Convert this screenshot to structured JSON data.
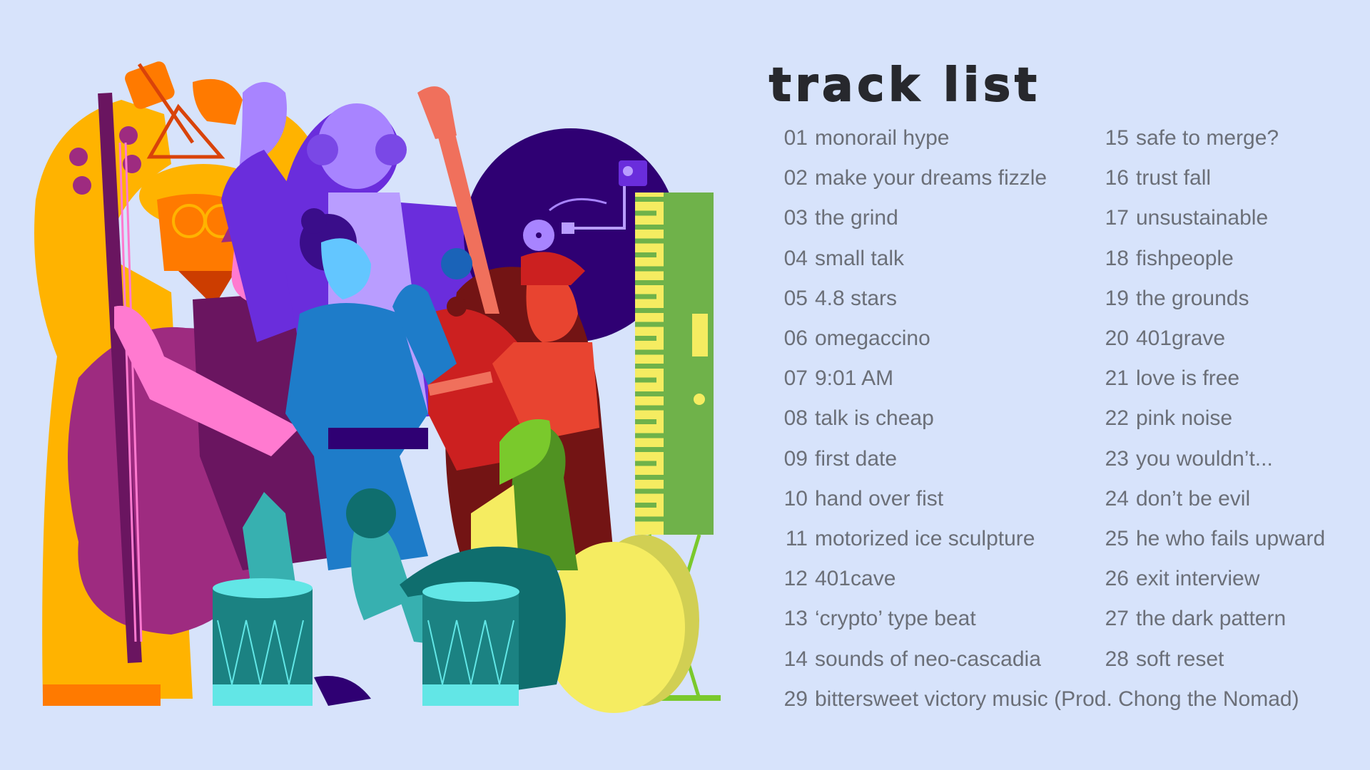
{
  "title": "track list",
  "colors": {
    "background": "#d7e3fb",
    "title": "#27282d",
    "track_text": "#6b6f78"
  },
  "illustration": {
    "subject": "band of musicians playing instruments",
    "instruments": [
      "triangle",
      "double bass",
      "turntable",
      "acoustic guitar",
      "saxophone",
      "keyboard",
      "bongo drums",
      "tambourine"
    ]
  },
  "tracks_left": [
    {
      "num": "01",
      "name": "monorail hype"
    },
    {
      "num": "02",
      "name": "make your dreams fizzle"
    },
    {
      "num": "03",
      "name": "the grind"
    },
    {
      "num": "04",
      "name": "small talk"
    },
    {
      "num": "05",
      "name": "4.8 stars"
    },
    {
      "num": "06",
      "name": "omegaccino"
    },
    {
      "num": "07",
      "name": "9:01 AM"
    },
    {
      "num": "08",
      "name": "talk is cheap"
    },
    {
      "num": "09",
      "name": "first date"
    },
    {
      "num": "10",
      "name": "hand over fist"
    },
    {
      "num": "11",
      "name": "motorized ice sculpture"
    },
    {
      "num": "12",
      "name": "401cave"
    },
    {
      "num": "13",
      "name": "‘crypto’ type beat"
    },
    {
      "num": "14",
      "name": "sounds of neo-cascadia"
    }
  ],
  "tracks_right": [
    {
      "num": "15",
      "name": "safe to merge?"
    },
    {
      "num": "16",
      "name": "trust fall"
    },
    {
      "num": "17",
      "name": "unsustainable"
    },
    {
      "num": "18",
      "name": "fishpeople"
    },
    {
      "num": "19",
      "name": "the grounds"
    },
    {
      "num": "20",
      "name": "401grave"
    },
    {
      "num": "21",
      "name": "love is free"
    },
    {
      "num": "22",
      "name": "pink noise"
    },
    {
      "num": "23",
      "name": "you wouldn’t..."
    },
    {
      "num": "24",
      "name": "don’t be evil"
    },
    {
      "num": "25",
      "name": "he who fails upward"
    },
    {
      "num": "26",
      "name": "exit interview"
    },
    {
      "num": "27",
      "name": "the dark pattern"
    },
    {
      "num": "28",
      "name": "soft reset"
    }
  ],
  "track_final": {
    "num": "29",
    "name": "bittersweet victory music (Prod. Chong the Nomad)"
  }
}
